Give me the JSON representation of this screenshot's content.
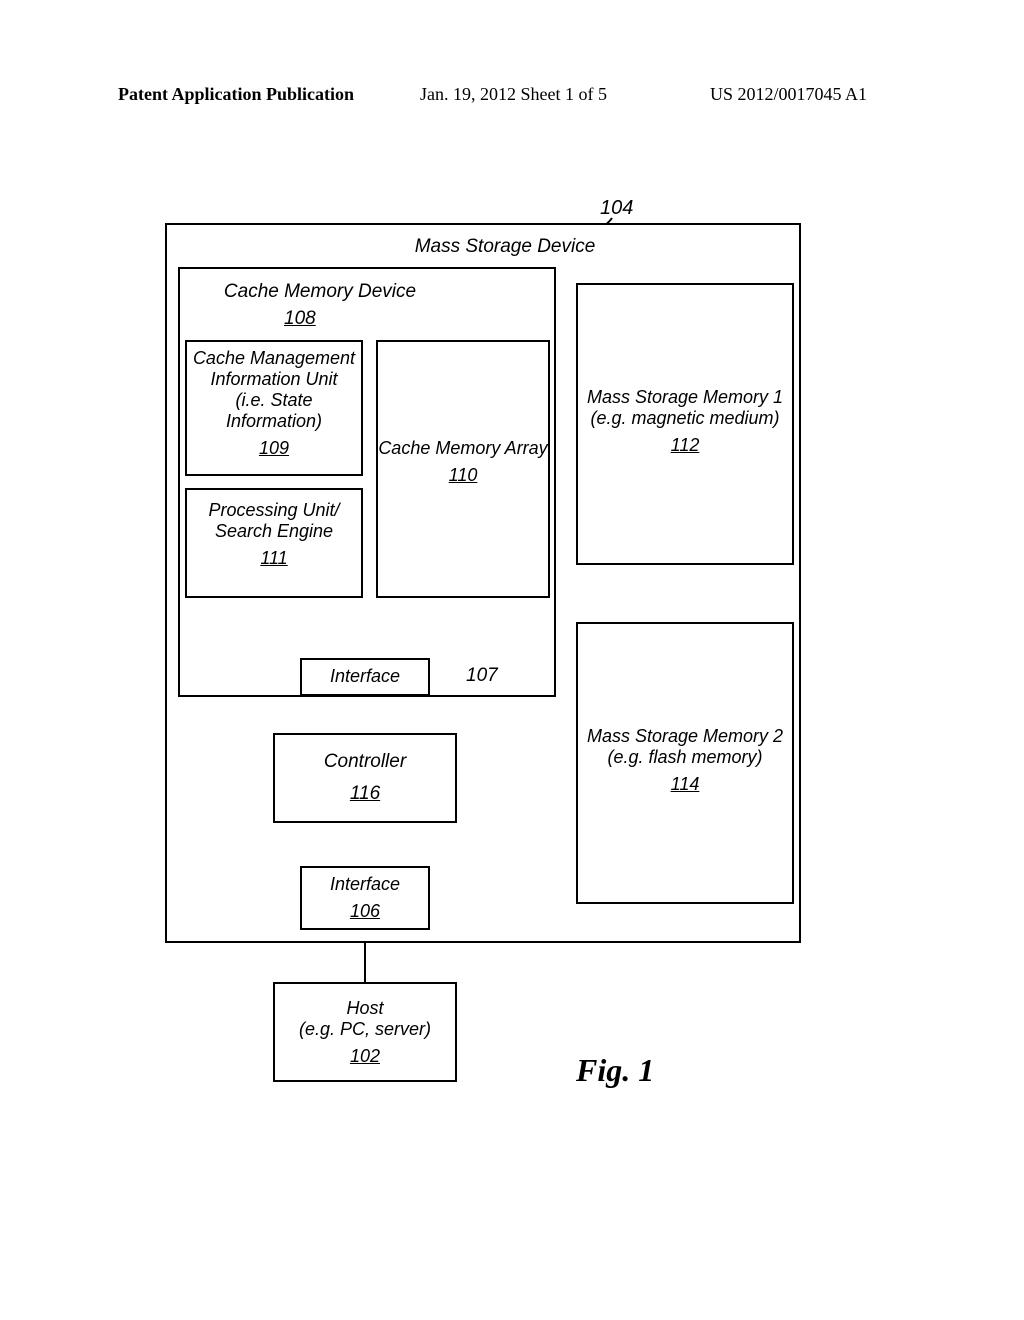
{
  "header": {
    "left": "Patent Application Publication",
    "mid": "Jan. 19, 2012  Sheet 1 of 5",
    "right": "US 2012/0017045 A1"
  },
  "callouts": {
    "ref104": "104",
    "ref107": "107"
  },
  "massStorage": {
    "title": "Mass Storage Device"
  },
  "cacheDevice": {
    "title": "Cache Memory Device",
    "ref": "108"
  },
  "cmiu": {
    "l1": "Cache Management",
    "l2": "Information Unit",
    "l3": "(i.e. State Information)",
    "ref": "109"
  },
  "procUnit": {
    "l1": "Processing Unit/",
    "l2": "Search Engine",
    "ref": "111"
  },
  "cacheArray": {
    "l1": "Cache Memory Array",
    "ref": "110"
  },
  "iface107": {
    "label": "Interface"
  },
  "controller": {
    "label": "Controller",
    "ref": "116"
  },
  "iface106": {
    "label": "Interface",
    "ref": "106"
  },
  "msm1": {
    "l1": "Mass Storage Memory 1",
    "l2": "(e.g. magnetic medium)",
    "ref": "112"
  },
  "msm2": {
    "l1": "Mass Storage Memory 2",
    "l2": "(e.g. flash memory)",
    "ref": "114"
  },
  "host": {
    "l1": "Host",
    "l2": "(e.g. PC, server)",
    "ref": "102"
  },
  "figlabel": "Fig. 1"
}
